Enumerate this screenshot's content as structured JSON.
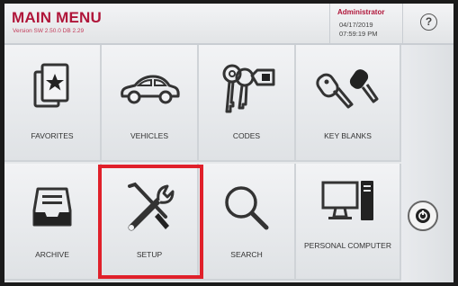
{
  "header": {
    "title": "MAIN MENU",
    "version": "Version SW 2.50.0 DB 2.29",
    "user": "Administrator",
    "date": "04/17/2019",
    "time": "07:59:19 PM",
    "help_icon": "?"
  },
  "tiles": [
    {
      "label": "FAVORITES",
      "icon": "favorites-icon"
    },
    {
      "label": "VEHICLES",
      "icon": "car-icon"
    },
    {
      "label": "CODES",
      "icon": "keys-tag-icon"
    },
    {
      "label": "KEY BLANKS",
      "icon": "key-blanks-icon"
    },
    {
      "label": "ARCHIVE",
      "icon": "archive-tray-icon"
    },
    {
      "label": "SETUP",
      "icon": "tools-icon"
    },
    {
      "label": "SEARCH",
      "icon": "magnifier-icon"
    },
    {
      "label": "PERSONAL COMPUTER",
      "icon": "computer-icon"
    }
  ],
  "power_icon": "power-icon",
  "highlight_color": "#e0202a",
  "accent_color": "#b0163a"
}
